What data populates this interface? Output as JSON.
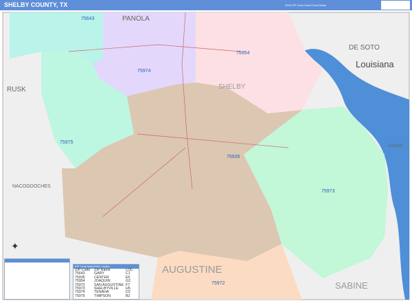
{
  "header": {
    "title": "SHELBY COUNTY, TX",
    "edition": "2026 ZIP Code Color/Cast Edition"
  },
  "map": {
    "region_labels": [
      "PANOLA",
      "DE SOTO",
      "Louisiana",
      "RUSK",
      "SHELBY",
      "SABINE",
      "NACOGDOCHES",
      "AUGUSTINE",
      "SABINE"
    ],
    "zip_labels": [
      "75643",
      "75954",
      "75974",
      "75975",
      "75935",
      "75973",
      "75972"
    ],
    "colors": {
      "water": "#4f8fd8",
      "outside": "#efefef"
    }
  },
  "zip_table": {
    "title": "ZIP Code Index/Grid Locator",
    "headers": [
      "ZIP Code",
      "ZIP Name",
      "LOC"
    ],
    "rows": [
      [
        "75643",
        "GARY",
        "C1"
      ],
      [
        "75935",
        "CENTER",
        "E5"
      ],
      [
        "75954",
        "JOAQUIN",
        "G2"
      ],
      [
        "75972",
        "SAN AUGUSTINE",
        "F7"
      ],
      [
        "75973",
        "SHELBYVILLE",
        "H5"
      ],
      [
        "75974",
        "TENAHA",
        "D2"
      ],
      [
        "75975",
        "TIMPSON",
        "B2"
      ]
    ]
  }
}
